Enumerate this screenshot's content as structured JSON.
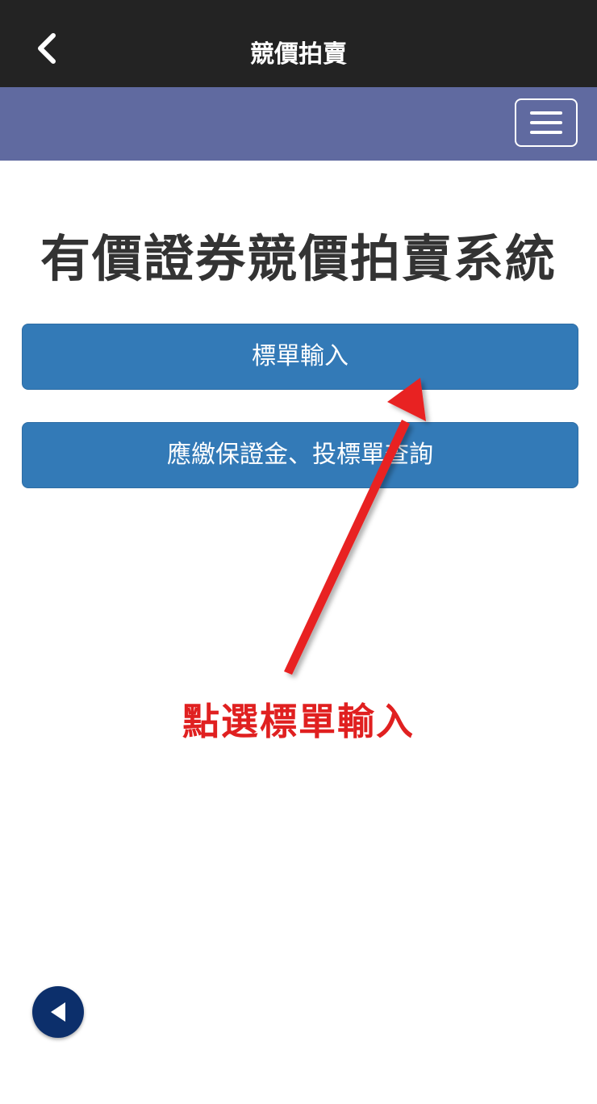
{
  "header": {
    "title": "競價拍賣",
    "back_icon": "chevron-left-icon"
  },
  "navbar": {
    "menu_icon": "hamburger-menu-icon",
    "color": "#606aa0"
  },
  "main": {
    "title": "有價證券競價拍賣系統",
    "buttons": [
      {
        "label": "標單輸入"
      },
      {
        "label": "應繳保證金、投標單查詢"
      }
    ]
  },
  "annotation": {
    "label": "點選標單輸入",
    "color": "#e02020"
  },
  "floating": {
    "icon": "triangle-left-icon"
  },
  "colors": {
    "topbar": "#232323",
    "button": "#337ab7",
    "title_text": "#333333"
  }
}
